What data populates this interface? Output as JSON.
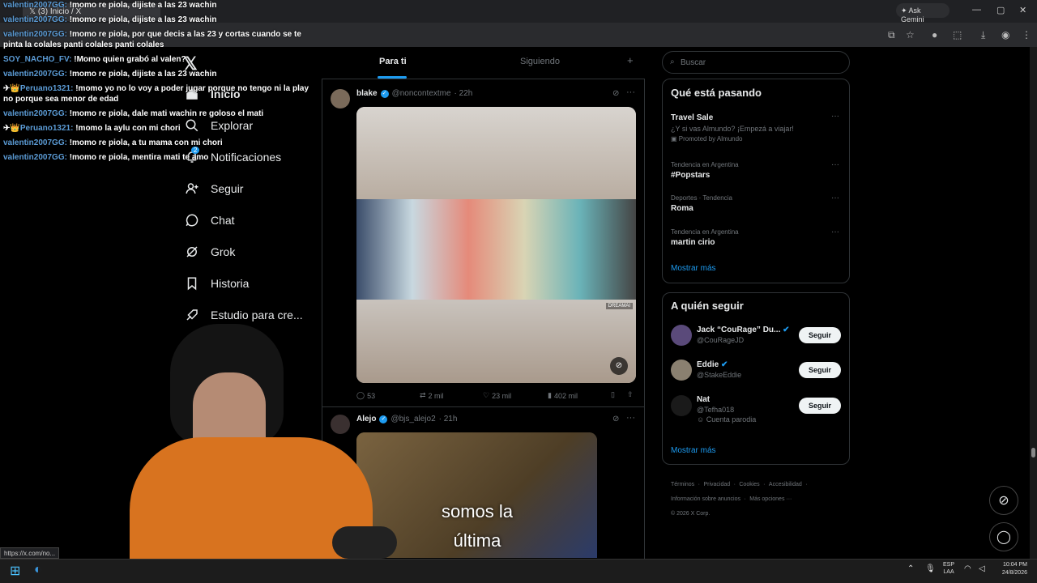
{
  "browser": {
    "tab_title": "(3) Inicio / X",
    "ask_gemini": "Ask Gemini",
    "status_url": "https://x.com/no..."
  },
  "nav": {
    "items": [
      {
        "label": "Inicio",
        "icon": "home-icon"
      },
      {
        "label": "Explorar",
        "icon": "search-icon"
      },
      {
        "label": "Notificaciones",
        "icon": "bell-icon",
        "badge": "2"
      },
      {
        "label": "Seguir",
        "icon": "person-add-icon"
      },
      {
        "label": "Chat",
        "icon": "chat-icon"
      },
      {
        "label": "Grok",
        "icon": "grok-icon"
      },
      {
        "label": "Historia",
        "icon": "bookmark-icon"
      },
      {
        "label": "Estudio para cre...",
        "icon": "rocket-icon"
      }
    ]
  },
  "feed": {
    "tabs": [
      "Para ti",
      "Siguiendo"
    ],
    "add_tab": "+",
    "posts": [
      {
        "name": "blake",
        "handle": "@noncontextme",
        "time": "· 22h",
        "metrics": {
          "replies": "53",
          "reposts": "2 mil",
          "likes": "23 mil",
          "views": "402 mil"
        },
        "image_watermark": "DREAMAI"
      },
      {
        "name": "Alejo",
        "handle": "@bjs_alejo2",
        "time": "· 21h",
        "image_caption": "somos la\núltima"
      }
    ]
  },
  "right": {
    "search_placeholder": "Buscar",
    "trends_title": "Qué está pasando",
    "trends": [
      {
        "context": "",
        "name": "Travel Sale",
        "desc": "¿Y si vas Almundo? ¡Empezá a viajar!",
        "promo": "Promoted by Almundo"
      },
      {
        "context": "Tendencia en Argentina",
        "name": "#Popstars"
      },
      {
        "context": "Deportes · Tendencia",
        "name": "Roma"
      },
      {
        "context": "Tendencia en Argentina",
        "name": "martin cirio"
      }
    ],
    "show_more": "Mostrar más",
    "who_title": "A quién seguir",
    "who": [
      {
        "name": "Jack “CouRage” Du...",
        "handle": "@CouRageJD",
        "extra": ""
      },
      {
        "name": "Eddie",
        "handle": "@StakeEddie",
        "extra": ""
      },
      {
        "name": "Nat",
        "handle": "@Tefha018",
        "extra": "Cuenta parodia"
      }
    ],
    "follow_label": "Seguir",
    "footer": [
      "Términos",
      "Privacidad",
      "Cookies",
      "Accesibilidad",
      "Información sobre anuncios",
      "Más opciones ···",
      "© 2026 X Corp."
    ]
  },
  "chat": [
    {
      "user": "valentin2007GG:",
      "msg": "!momo re piola, dijiste a las 23 wachin"
    },
    {
      "user": "valentin2007GG:",
      "msg": "!momo re piola, dijiste a las 23 wachin"
    },
    {
      "user": "valentin2007GG:",
      "msg": "!momo re piola, por que decis a las 23 y cortas cuando se te pinta la colales panti colales panti colales"
    },
    {
      "user": "SOY_NACHO_FV:",
      "msg": "!Momo quien grabó al valen?"
    },
    {
      "user": "valentin2007GG:",
      "msg": "!momo re piola, dijiste a las 23 wachin"
    },
    {
      "user": "Peruano1321:",
      "msg": "!momo yo no lo voy a poder jugar porque no tengo ni la play no porque sea menor de edad"
    },
    {
      "user": "valentin2007GG:",
      "msg": "!momo re piola, dale mati wachin re goloso el mati"
    },
    {
      "user": "Peruano1321:",
      "msg": "!momo la aylu con mi chori"
    },
    {
      "user": "valentin2007GG:",
      "msg": "!momo re piola, a tu mama con mi chori"
    },
    {
      "user": "valentin2007GG:",
      "msg": "!momo re piola, mentira mati te amo"
    }
  ],
  "taskbar": {
    "lang": "ESP\nLAA",
    "time": "10:04 PM",
    "date": "24/8/2026"
  },
  "colors": {
    "accent": "#1d9bf0",
    "bg": "#000000",
    "border": "#2f3336",
    "muted": "#71767b"
  }
}
